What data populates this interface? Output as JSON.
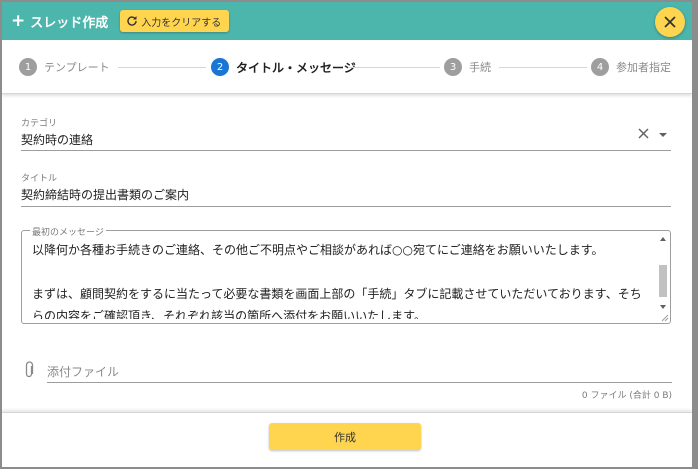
{
  "header": {
    "title": "スレッド作成",
    "clear_button": "入力をクリアする"
  },
  "stepper": {
    "steps": [
      {
        "num": "1",
        "label": "テンプレート"
      },
      {
        "num": "2",
        "label": "タイトル・メッセージ"
      },
      {
        "num": "3",
        "label": "手続"
      },
      {
        "num": "4",
        "label": "参加者指定"
      }
    ],
    "active_index": 1
  },
  "category": {
    "label": "カテゴリ",
    "value": "契約時の連絡"
  },
  "title_field": {
    "label": "タイトル",
    "value": "契約締結時の提出書類のご案内"
  },
  "message": {
    "label": "最初のメッセージ",
    "value": "以降何か各種お手続きのご連絡、その他ご不明点やご相談があれば○○宛てにご連絡をお願いいたします。\n\nまずは、顧問契約をするに当たって必要な書類を画面上部の「手続」タブに記載させていただいております、そちらの内容をご確認頂き、それぞれ該当の箇所へ添付をお願いいたします。"
  },
  "attachment": {
    "placeholder": "添付ファイル",
    "count_text": "0 ファイル (合計 0 B)"
  },
  "footer": {
    "create_button": "作成"
  },
  "colors": {
    "header_bg": "#4db6ac",
    "accent_yellow": "#ffd54f",
    "active_step": "#1976d2",
    "inactive_step": "#9e9e9e"
  },
  "icons": {
    "add": "plus-icon",
    "clear": "refresh-icon",
    "close": "close-icon",
    "category_clear": "close-icon",
    "dropdown": "chevron-down-icon",
    "attachment": "paperclip-icon"
  }
}
